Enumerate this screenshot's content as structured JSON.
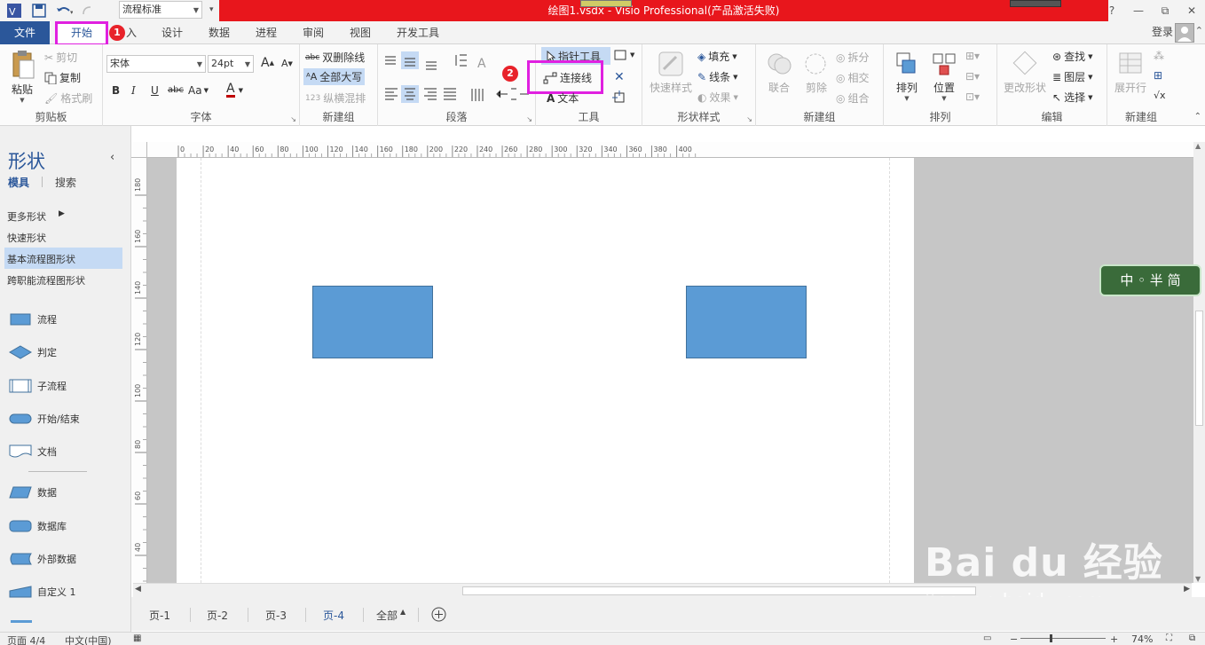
{
  "titlebar": {
    "style_combo": "流程标准",
    "title": "绘图1.vsdx -  Visio Professional(产品激活失败)",
    "help": "?",
    "restore": "⧉",
    "minimize": "—",
    "close": "✕"
  },
  "tabs": {
    "file": "文件",
    "home": "开始",
    "insert": "入",
    "design": "设计",
    "data": "数据",
    "process": "进程",
    "review": "审阅",
    "view": "视图",
    "developer": "开发工具",
    "login": "登录"
  },
  "badges": {
    "one": "1",
    "two": "2"
  },
  "ribbon": {
    "clipboard": {
      "label": "剪贴板",
      "paste": "粘贴",
      "cut": "剪切",
      "copy": "复制",
      "format_painter": "格式刷"
    },
    "font": {
      "label": "字体",
      "family": "宋体",
      "size": "24pt",
      "bold": "B",
      "italic": "I",
      "underline": "U",
      "strike": "abc",
      "case": "Aa",
      "color": "A"
    },
    "newgroup1": {
      "label": "新建组",
      "double_strike": "双删除线",
      "all_caps": "全部大写",
      "vertical": "纵横混排"
    },
    "paragraph": {
      "label": "段落"
    },
    "tools": {
      "label": "工具",
      "pointer": "指针工具",
      "connector": "连接线",
      "text": "文本"
    },
    "shape_styles": {
      "label": "形状样式",
      "quick_styles": "快速样式",
      "fill": "填充",
      "line": "线条",
      "effects": "效果"
    },
    "newgroup2": {
      "label": "新建组",
      "union": "联合",
      "fragment": "剪除",
      "split": "拆分",
      "intersect": "相交",
      "combine": "组合"
    },
    "arrange": {
      "label": "排列",
      "arrange": "排列",
      "position": "位置"
    },
    "edit": {
      "label": "编辑",
      "change_shape": "更改形状",
      "find": "查找",
      "layers": "图层",
      "select": "选择"
    },
    "newgroup3": {
      "label": "新建组",
      "parallel": "展开行"
    }
  },
  "panel": {
    "title": "形状",
    "tab_stencils": "模具",
    "tab_search": "搜索",
    "more_shapes": "更多形状",
    "quick_shapes": "快速形状",
    "basic_flowchart": "基本流程图形状",
    "cross_functional": "跨职能流程图形状",
    "items": [
      "流程",
      "判定",
      "子流程",
      "开始/结束",
      "文档",
      "数据",
      "数据库",
      "外部数据",
      "自定义 1"
    ]
  },
  "ruler": {
    "h_ticks": [
      "0",
      "20",
      "40",
      "60",
      "80",
      "100",
      "120",
      "140",
      "160",
      "180",
      "200",
      "220",
      "240",
      "260",
      "280",
      "300",
      "320",
      "340",
      "360",
      "380",
      "400"
    ],
    "v_ticks": [
      "180",
      "160",
      "140",
      "120",
      "100",
      "80",
      "60",
      "40"
    ]
  },
  "pages": {
    "p1": "页-1",
    "p2": "页-2",
    "p3": "页-3",
    "p4": "页-4",
    "all": "全部"
  },
  "status": {
    "page": "页面 4/4",
    "lang": "中文(中国)",
    "zoom": "74%"
  },
  "watermark": {
    "ime": "中 ◦ 半 简",
    "brand": "Bai du 经验",
    "url": "jingyan.baidu.com"
  },
  "colors": {
    "accent": "#2b579a",
    "title_red": "#e8161c",
    "highlight": "#e020e0",
    "shape_fill": "#5b9bd5"
  }
}
